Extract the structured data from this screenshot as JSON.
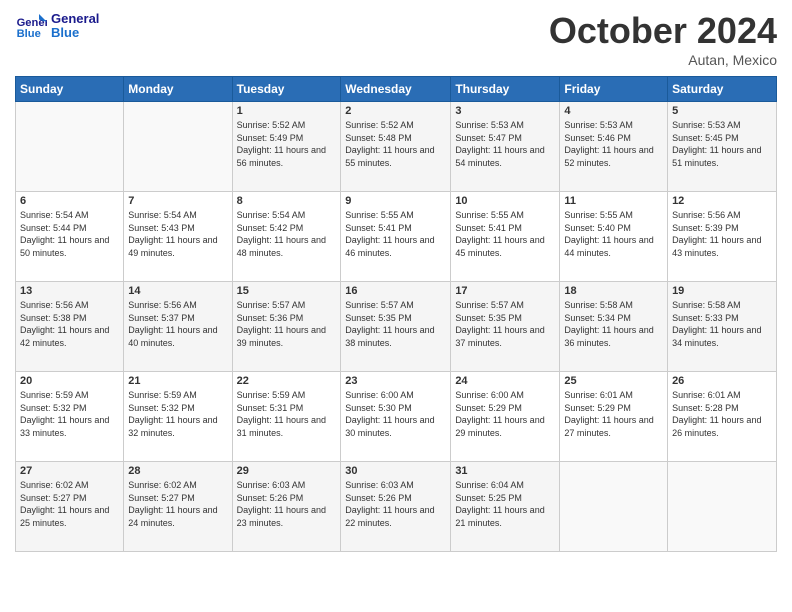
{
  "header": {
    "logo_text_general": "General",
    "logo_text_blue": "Blue",
    "month_title": "October 2024",
    "location": "Autan, Mexico"
  },
  "days_of_week": [
    "Sunday",
    "Monday",
    "Tuesday",
    "Wednesday",
    "Thursday",
    "Friday",
    "Saturday"
  ],
  "weeks": [
    [
      {
        "day": "",
        "info": ""
      },
      {
        "day": "",
        "info": ""
      },
      {
        "day": "1",
        "sunrise": "Sunrise: 5:52 AM",
        "sunset": "Sunset: 5:49 PM",
        "daylight": "Daylight: 11 hours and 56 minutes."
      },
      {
        "day": "2",
        "sunrise": "Sunrise: 5:52 AM",
        "sunset": "Sunset: 5:48 PM",
        "daylight": "Daylight: 11 hours and 55 minutes."
      },
      {
        "day": "3",
        "sunrise": "Sunrise: 5:53 AM",
        "sunset": "Sunset: 5:47 PM",
        "daylight": "Daylight: 11 hours and 54 minutes."
      },
      {
        "day": "4",
        "sunrise": "Sunrise: 5:53 AM",
        "sunset": "Sunset: 5:46 PM",
        "daylight": "Daylight: 11 hours and 52 minutes."
      },
      {
        "day": "5",
        "sunrise": "Sunrise: 5:53 AM",
        "sunset": "Sunset: 5:45 PM",
        "daylight": "Daylight: 11 hours and 51 minutes."
      }
    ],
    [
      {
        "day": "6",
        "sunrise": "Sunrise: 5:54 AM",
        "sunset": "Sunset: 5:44 PM",
        "daylight": "Daylight: 11 hours and 50 minutes."
      },
      {
        "day": "7",
        "sunrise": "Sunrise: 5:54 AM",
        "sunset": "Sunset: 5:43 PM",
        "daylight": "Daylight: 11 hours and 49 minutes."
      },
      {
        "day": "8",
        "sunrise": "Sunrise: 5:54 AM",
        "sunset": "Sunset: 5:42 PM",
        "daylight": "Daylight: 11 hours and 48 minutes."
      },
      {
        "day": "9",
        "sunrise": "Sunrise: 5:55 AM",
        "sunset": "Sunset: 5:41 PM",
        "daylight": "Daylight: 11 hours and 46 minutes."
      },
      {
        "day": "10",
        "sunrise": "Sunrise: 5:55 AM",
        "sunset": "Sunset: 5:41 PM",
        "daylight": "Daylight: 11 hours and 45 minutes."
      },
      {
        "day": "11",
        "sunrise": "Sunrise: 5:55 AM",
        "sunset": "Sunset: 5:40 PM",
        "daylight": "Daylight: 11 hours and 44 minutes."
      },
      {
        "day": "12",
        "sunrise": "Sunrise: 5:56 AM",
        "sunset": "Sunset: 5:39 PM",
        "daylight": "Daylight: 11 hours and 43 minutes."
      }
    ],
    [
      {
        "day": "13",
        "sunrise": "Sunrise: 5:56 AM",
        "sunset": "Sunset: 5:38 PM",
        "daylight": "Daylight: 11 hours and 42 minutes."
      },
      {
        "day": "14",
        "sunrise": "Sunrise: 5:56 AM",
        "sunset": "Sunset: 5:37 PM",
        "daylight": "Daylight: 11 hours and 40 minutes."
      },
      {
        "day": "15",
        "sunrise": "Sunrise: 5:57 AM",
        "sunset": "Sunset: 5:36 PM",
        "daylight": "Daylight: 11 hours and 39 minutes."
      },
      {
        "day": "16",
        "sunrise": "Sunrise: 5:57 AM",
        "sunset": "Sunset: 5:35 PM",
        "daylight": "Daylight: 11 hours and 38 minutes."
      },
      {
        "day": "17",
        "sunrise": "Sunrise: 5:57 AM",
        "sunset": "Sunset: 5:35 PM",
        "daylight": "Daylight: 11 hours and 37 minutes."
      },
      {
        "day": "18",
        "sunrise": "Sunrise: 5:58 AM",
        "sunset": "Sunset: 5:34 PM",
        "daylight": "Daylight: 11 hours and 36 minutes."
      },
      {
        "day": "19",
        "sunrise": "Sunrise: 5:58 AM",
        "sunset": "Sunset: 5:33 PM",
        "daylight": "Daylight: 11 hours and 34 minutes."
      }
    ],
    [
      {
        "day": "20",
        "sunrise": "Sunrise: 5:59 AM",
        "sunset": "Sunset: 5:32 PM",
        "daylight": "Daylight: 11 hours and 33 minutes."
      },
      {
        "day": "21",
        "sunrise": "Sunrise: 5:59 AM",
        "sunset": "Sunset: 5:32 PM",
        "daylight": "Daylight: 11 hours and 32 minutes."
      },
      {
        "day": "22",
        "sunrise": "Sunrise: 5:59 AM",
        "sunset": "Sunset: 5:31 PM",
        "daylight": "Daylight: 11 hours and 31 minutes."
      },
      {
        "day": "23",
        "sunrise": "Sunrise: 6:00 AM",
        "sunset": "Sunset: 5:30 PM",
        "daylight": "Daylight: 11 hours and 30 minutes."
      },
      {
        "day": "24",
        "sunrise": "Sunrise: 6:00 AM",
        "sunset": "Sunset: 5:29 PM",
        "daylight": "Daylight: 11 hours and 29 minutes."
      },
      {
        "day": "25",
        "sunrise": "Sunrise: 6:01 AM",
        "sunset": "Sunset: 5:29 PM",
        "daylight": "Daylight: 11 hours and 27 minutes."
      },
      {
        "day": "26",
        "sunrise": "Sunrise: 6:01 AM",
        "sunset": "Sunset: 5:28 PM",
        "daylight": "Daylight: 11 hours and 26 minutes."
      }
    ],
    [
      {
        "day": "27",
        "sunrise": "Sunrise: 6:02 AM",
        "sunset": "Sunset: 5:27 PM",
        "daylight": "Daylight: 11 hours and 25 minutes."
      },
      {
        "day": "28",
        "sunrise": "Sunrise: 6:02 AM",
        "sunset": "Sunset: 5:27 PM",
        "daylight": "Daylight: 11 hours and 24 minutes."
      },
      {
        "day": "29",
        "sunrise": "Sunrise: 6:03 AM",
        "sunset": "Sunset: 5:26 PM",
        "daylight": "Daylight: 11 hours and 23 minutes."
      },
      {
        "day": "30",
        "sunrise": "Sunrise: 6:03 AM",
        "sunset": "Sunset: 5:26 PM",
        "daylight": "Daylight: 11 hours and 22 minutes."
      },
      {
        "day": "31",
        "sunrise": "Sunrise: 6:04 AM",
        "sunset": "Sunset: 5:25 PM",
        "daylight": "Daylight: 11 hours and 21 minutes."
      },
      {
        "day": "",
        "info": ""
      },
      {
        "day": "",
        "info": ""
      }
    ]
  ]
}
